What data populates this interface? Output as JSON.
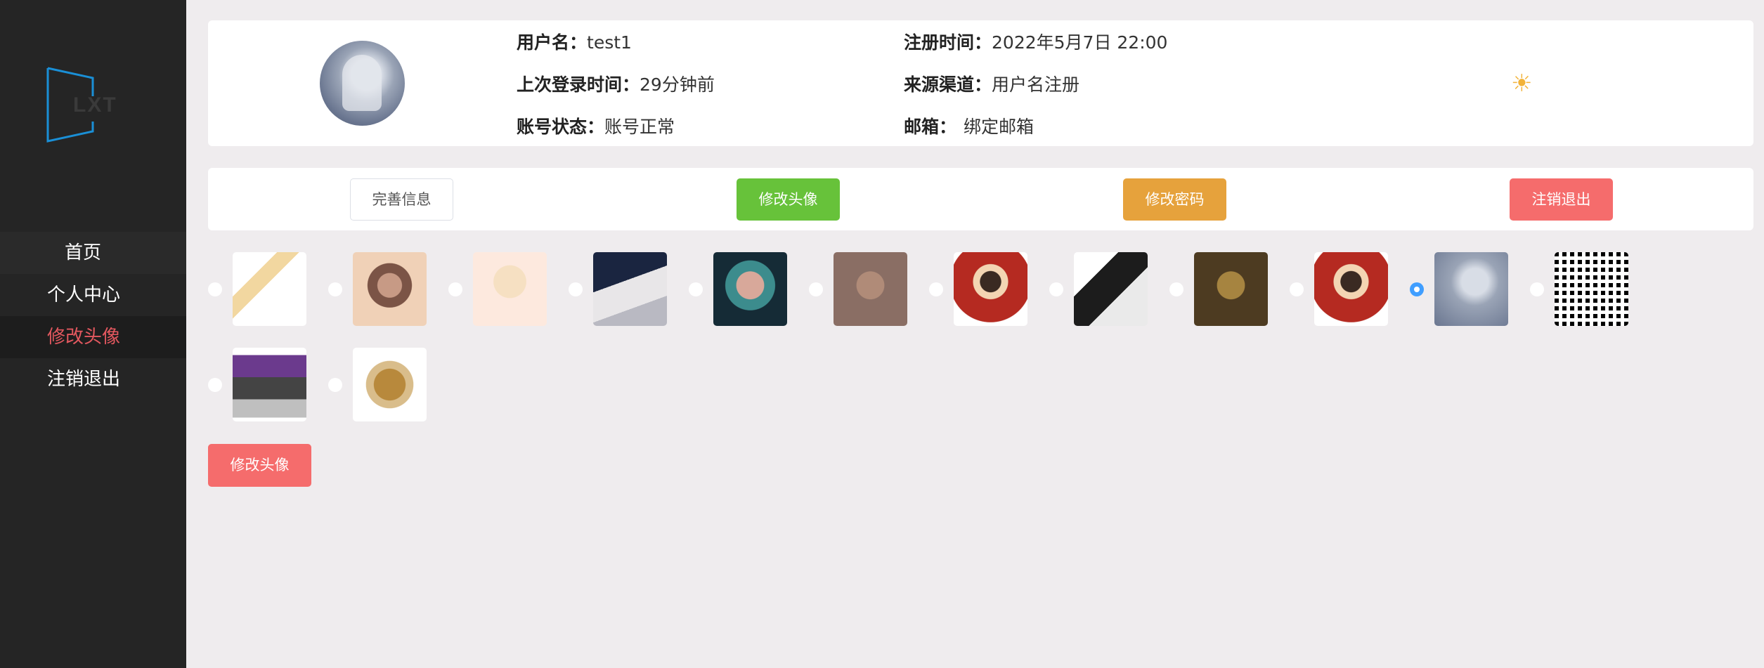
{
  "sidebar": {
    "logo_text": "LXT",
    "items": [
      {
        "label": "首页"
      },
      {
        "label": "个人中心"
      },
      {
        "label": "修改头像"
      },
      {
        "label": "注销退出"
      }
    ],
    "active_color": "#e3585f"
  },
  "profile": {
    "username_label": "用户名：",
    "username": "test1",
    "register_label": "注册时间：",
    "register_time": "2022年5月7日 22:00",
    "last_login_label": "上次登录时间：",
    "last_login": "29分钟前",
    "source_label": "来源渠道：",
    "source": "用户名注册",
    "status_label": "账号状态：",
    "status": "账号正常",
    "email_label": "邮箱：",
    "email": "绑定邮箱",
    "theme_icon": "sun-icon"
  },
  "actions": {
    "complete_info": "完善信息",
    "change_avatar": "修改头像",
    "change_password": "修改密码",
    "logout": "注销退出"
  },
  "avatar_options": {
    "count": 14,
    "selected_index": 10
  },
  "submit": {
    "label": "修改头像"
  },
  "colors": {
    "success": "#67c23a",
    "warning": "#e6a23c",
    "danger": "#f56c6c",
    "primary": "#409eff"
  }
}
